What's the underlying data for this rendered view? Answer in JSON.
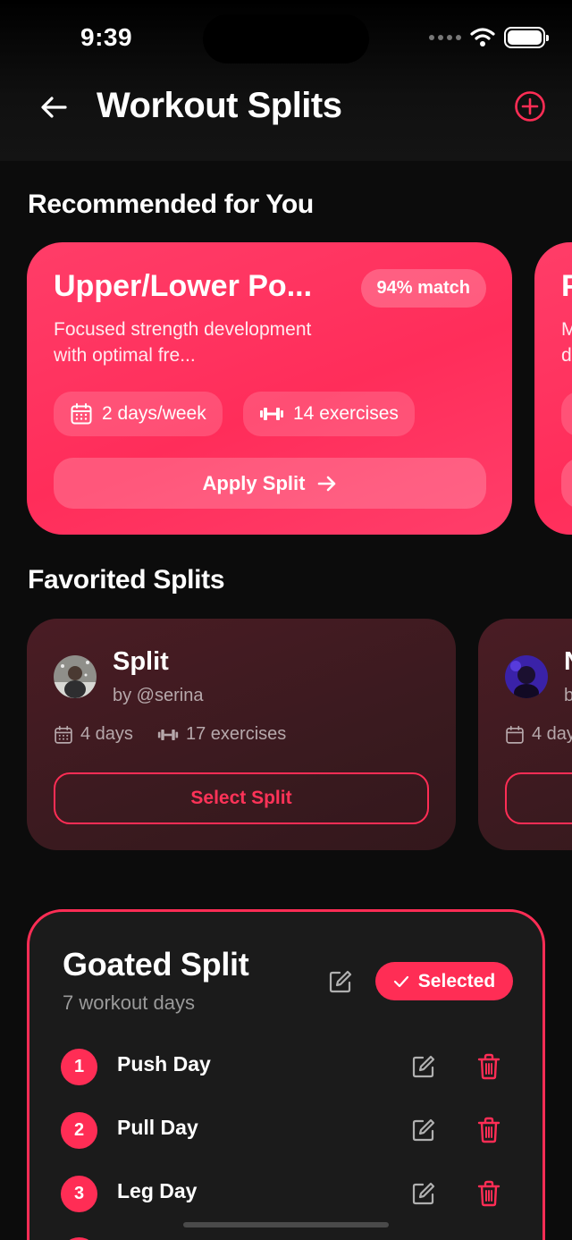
{
  "status_bar": {
    "time": "9:39"
  },
  "header": {
    "title": "Workout Splits"
  },
  "recommended": {
    "section_title": "Recommended for You",
    "card": {
      "title": "Upper/Lower Po...",
      "match": "94% match",
      "description": "Focused strength development with optimal fre...",
      "days": "2 days/week",
      "exercises": "14 exercises",
      "apply_label": "Apply Split"
    },
    "peek_card": {
      "title": "P",
      "desc_line1": "M",
      "desc_line2": "d"
    }
  },
  "favorited": {
    "section_title": "Favorited Splits",
    "cards": [
      {
        "name": "Split",
        "author": "by @serina",
        "days": "4 days",
        "exercises": "17 exercises",
        "select_label": "Select Split"
      },
      {
        "name": "N",
        "author": "b",
        "days": "4 day"
      }
    ]
  },
  "current_split": {
    "title": "Goated Split",
    "subtitle": "7 workout days",
    "selected_label": "Selected",
    "days": [
      {
        "num": "1",
        "name": "Push Day"
      },
      {
        "num": "2",
        "name": "Pull Day"
      },
      {
        "num": "3",
        "name": "Leg Day"
      }
    ]
  },
  "colors": {
    "accent": "#ff2d55",
    "background": "#0c0c0c",
    "card_fav": "#3a1a1f"
  },
  "icons": [
    "arrow-left-icon",
    "plus-circle-icon",
    "calendar-icon",
    "dumbbell-icon",
    "arrow-right-icon",
    "edit-icon",
    "trash-icon",
    "check-icon",
    "wifi-icon",
    "battery-icon"
  ]
}
